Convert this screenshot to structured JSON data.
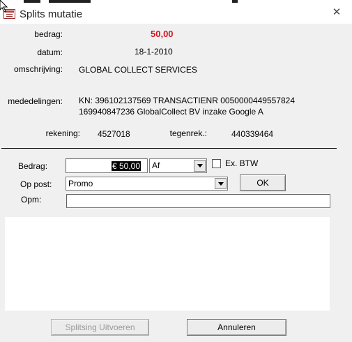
{
  "window": {
    "title": "Splits mutatie"
  },
  "info": {
    "bedrag_label": "bedrag:",
    "bedrag_value": "50,00",
    "datum_label": "datum:",
    "datum_value": "18-1-2010",
    "omschrijving_label": "omschrijving:",
    "omschrijving_value": "GLOBAL COLLECT SERVICES",
    "mededelingen_label": "mededelingen:",
    "mededelingen_line1": "KN: 396102137569 TRANSACTIENR 0050000449557824",
    "mededelingen_line2": "169940847236 GlobalCollect BV inzake Google A",
    "rekening_label": "rekening:",
    "rekening_value": "4527018",
    "tegenrek_label": "tegenrek.:",
    "tegenrek_value": "440339464"
  },
  "form": {
    "bedrag_label": "Bedrag:",
    "bedrag_value": "€ 50,00",
    "direction_value": "Af",
    "ex_btw_label": "Ex. BTW",
    "ex_btw_checked": false,
    "op_post_label": "Op post:",
    "op_post_value": "Promo",
    "ok_label": "OK",
    "opm_label": "Opm:",
    "opm_value": ""
  },
  "buttons": {
    "execute_label": "Splitsing Uitvoeren",
    "cancel_label": "Annuleren"
  },
  "colors": {
    "amount": "#d4141c",
    "window_bg": "#f0f0f0",
    "disabled_text": "#9a9a9a"
  }
}
